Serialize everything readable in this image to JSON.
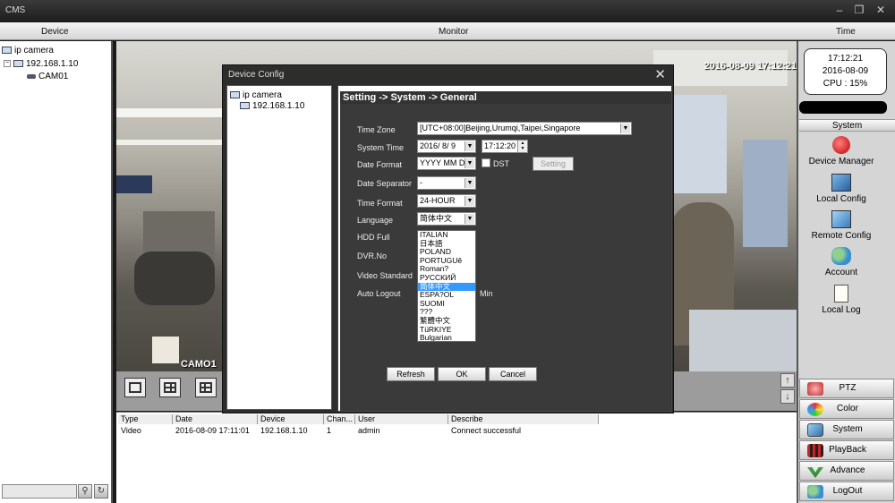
{
  "window": {
    "title": "CMS"
  },
  "columns": {
    "device": "Device",
    "monitor": "Monitor",
    "time": "Time"
  },
  "tree": {
    "root": "ip camera",
    "host": "192.168.1.10",
    "channel": "CAM01"
  },
  "video": {
    "timestamp": "2016-08-09 17:12:21",
    "camera_label": "CAMO1"
  },
  "clock": {
    "time": "17:12:21",
    "date": "2016-08-09",
    "cpu": "CPU : 15%"
  },
  "system_panel": {
    "header": "System",
    "tools": [
      "Device Manager",
      "Local Config",
      "Remote Config",
      "Account",
      "Local Log"
    ]
  },
  "bottom_buttons": [
    "PTZ",
    "Color",
    "System",
    "PlayBack",
    "Advance",
    "LogOut"
  ],
  "log": {
    "headers": [
      "Type",
      "Date",
      "Device",
      "Chan...",
      "User",
      "Describe"
    ],
    "rows": [
      [
        "Video",
        "2016-08-09 17:11:01",
        "192.168.1.10",
        "1",
        "admin",
        "Connect successful"
      ]
    ]
  },
  "dialog": {
    "title": "Device Config",
    "close": "✕",
    "tree": {
      "root": "ip camera",
      "host": "192.168.1.10"
    },
    "breadcrumb": "Setting -> System -> General",
    "fields": {
      "time_zone_label": "Time Zone",
      "time_zone_value": "[UTC+08:00]Beijing,Urumqi,Taipei,Singapore",
      "system_time_label": "System Time",
      "system_date_value": "2016/ 8/ 9",
      "system_time_value": "17:12:20",
      "date_format_label": "Date Format",
      "date_format_value": "YYYY MM DD",
      "dst_label": "DST",
      "setting_button": "Setting",
      "date_separator_label": "Date Separator",
      "date_separator_value": "-",
      "time_format_label": "Time Format",
      "time_format_value": "24-HOUR",
      "language_label": "Language",
      "language_value": "简体中文",
      "hdd_full_label": "HDD Full",
      "dvr_no_label": "DVR.No",
      "video_standard_label": "Video Standard",
      "auto_logout_label": "Auto Logout",
      "min_label": "Min"
    },
    "language_options": [
      "ITALIAN",
      "日本語",
      "POLAND",
      "PORTUGUê",
      "Roman?",
      "РУССКИЙ",
      "简体中文",
      "ESPA?OL",
      "SUOMI",
      "???",
      "繁體中文",
      "TüRKIYE",
      "Bulgarian"
    ],
    "language_selected_index": 6,
    "buttons": {
      "refresh": "Refresh",
      "ok": "OK",
      "cancel": "Cancel"
    }
  }
}
